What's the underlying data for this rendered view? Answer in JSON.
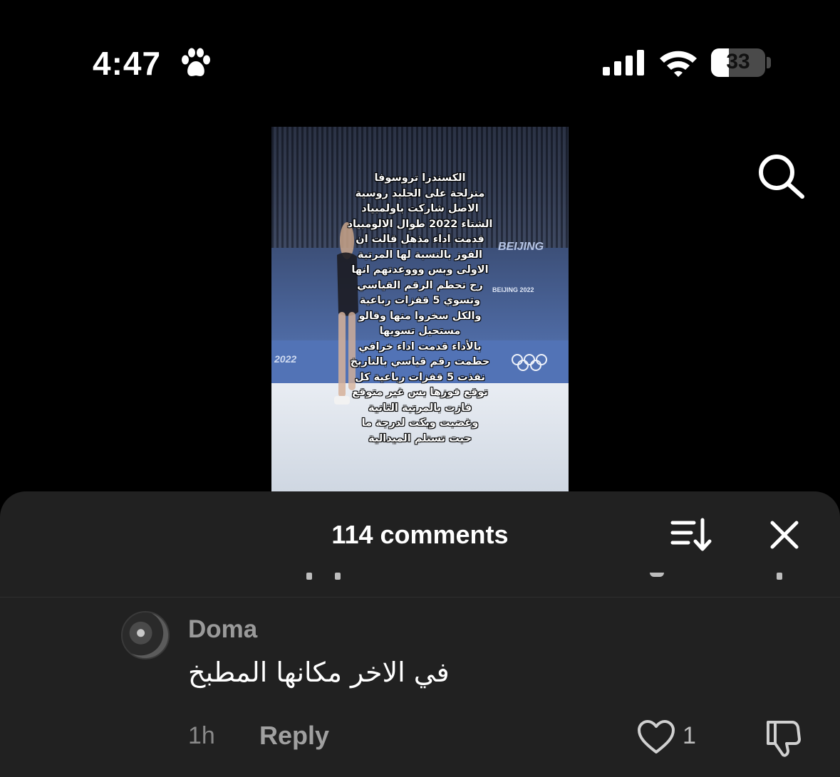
{
  "status_bar": {
    "time": "4:47",
    "battery_percent": "33",
    "battery_level": 0.33,
    "icons": [
      "paw-icon",
      "cellular-signal-icon",
      "wifi-icon",
      "battery-icon"
    ]
  },
  "header": {
    "search_icon": "search-icon"
  },
  "video": {
    "board_text_year": "2022",
    "board_text_beijing_small": "BEIJING 2022",
    "board_text_beijing_large": "BEIJING",
    "overlay_lines": [
      "الكسندرا تروسوفا",
      "متزلجة على الجليد روسية",
      "الاصل شاركت باولمبياد",
      "الشتاء 2022 طوال الالومبياد",
      "قدمت اداء مذهل قالت ان",
      "الفوز بالنسبة لها المرتبة",
      "الاولى وبس وووعدتهم انها",
      "رح تحطم الرقم القياسي",
      "وتسوي 5 قفزات رباعية",
      "والكل سخروا منها وقالو",
      "مستحيل تسويها",
      "بالأداء قدمت اداء خرافي",
      "حطمت رقم قياسي بالتاريخ",
      "نفذت 5 قفزات رباعية كل",
      "توقع فوزها بس غير متوقع",
      "فازت بالمرتبة الثانية",
      "وغضبت وبكت لدرجة ما",
      "حبت تستلم الميدالية"
    ]
  },
  "comments_panel": {
    "title": "114 comments",
    "sort_icon": "sort-icon",
    "close_icon": "close-icon",
    "comment": {
      "author": "Doma",
      "text": "في الاخر مكانها المطبخ",
      "time": "1h",
      "reply_label": "Reply",
      "like_count": "1",
      "like_icon": "heart-icon",
      "dislike_icon": "thumbs-down-icon"
    }
  }
}
